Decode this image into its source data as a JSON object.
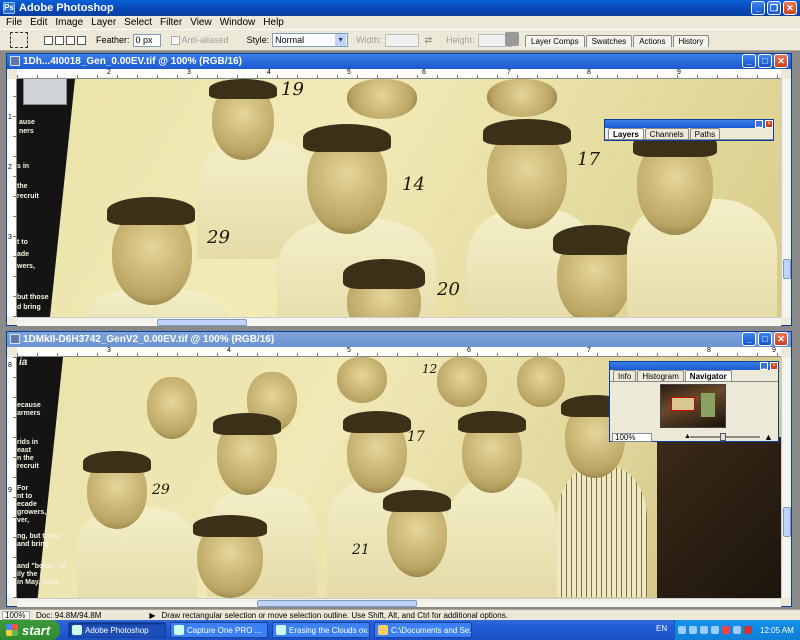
{
  "app": {
    "title": "Adobe Photoshop"
  },
  "menu": [
    "File",
    "Edit",
    "Image",
    "Layer",
    "Select",
    "Filter",
    "View",
    "Window",
    "Help"
  ],
  "options": {
    "feather_label": "Feather:",
    "feather_value": "0 px",
    "antialiased_label": "Anti-aliased",
    "style_label": "Style:",
    "style_value": "Normal",
    "width_label": "Width:",
    "height_label": "Height:"
  },
  "palette_well": [
    "Layer Comps",
    "Swatches",
    "Actions",
    "History"
  ],
  "doc1": {
    "title": "1Dh...4I0018_Gen_0.00EV.tif @ 100% (RGB/16)",
    "ruler_top": [
      "2",
      "3",
      "4",
      "5",
      "6",
      "7",
      "8",
      "9"
    ],
    "ruler_left": [
      "1",
      "2",
      "3"
    ],
    "placard": [
      "ause",
      "ners",
      "s in",
      "the",
      "recruit",
      "t to",
      "ade",
      "wers,",
      "but those",
      "d bring"
    ],
    "labels": [
      "19",
      "14",
      "17",
      "29",
      "20"
    ]
  },
  "doc2": {
    "title": "1DMkII-D6H3742_GenV2_0.00EV.tif @ 100% (RGB/16)",
    "ruler_top": [
      "3",
      "4",
      "5",
      "6",
      "7",
      "8",
      "9"
    ],
    "ruler_left": [
      "8",
      "9"
    ],
    "placard": [
      "ia",
      "ecause",
      "armers",
      "rids in",
      "east",
      "n the",
      "recruit",
      "For",
      "nt to",
      "ecade",
      "growers,",
      "ver,",
      "ng, but those",
      "and bring",
      "and \"boom\" of",
      "ily the",
      "in May, 1942."
    ],
    "labels": [
      "12",
      "17",
      "29",
      "21"
    ]
  },
  "layers_palette": {
    "tabs": [
      "Layers",
      "Channels",
      "Paths"
    ],
    "active": "Layers"
  },
  "navigator_palette": {
    "tabs": [
      "Info",
      "Histogram",
      "Navigator"
    ],
    "active": "Navigator",
    "zoom": "100%"
  },
  "status": {
    "zoom": "100%",
    "doc": "Doc: 94.8M/94.8M",
    "hint": "Draw rectangular selection or move selection outline.  Use Shift, Alt, and Ctrl for additional options."
  },
  "taskbar": {
    "start": "start",
    "tasks": [
      "Adobe Photoshop",
      "Capture One PRO ...",
      "Erasing the Clouds ov...",
      "C:\\Documents and Se..."
    ],
    "language": "EN",
    "clock": "12:05 AM"
  },
  "colors": {
    "xp_blue": "#0a5fd8",
    "start_green": "#2e8a2e",
    "sepia": "#ece3a8"
  }
}
